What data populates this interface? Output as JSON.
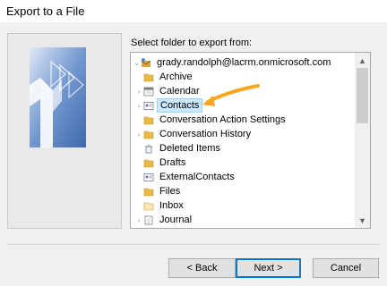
{
  "window": {
    "title": "Export to a File"
  },
  "prompt": "Select folder to export from:",
  "tree": {
    "account": "grady.randolph@lacrm.onmicrosoft.com",
    "items": [
      {
        "label": "Archive",
        "icon": "folder-icon"
      },
      {
        "label": "Calendar",
        "icon": "calendar-icon"
      },
      {
        "label": "Contacts",
        "icon": "contacts-icon"
      },
      {
        "label": "Conversation Action Settings",
        "icon": "folder-icon"
      },
      {
        "label": "Conversation History",
        "icon": "folder-icon"
      },
      {
        "label": "Deleted Items",
        "icon": "trash-icon"
      },
      {
        "label": "Drafts",
        "icon": "folder-icon"
      },
      {
        "label": "ExternalContacts",
        "icon": "contacts-icon"
      },
      {
        "label": "Files",
        "icon": "folder-icon"
      },
      {
        "label": "Inbox",
        "icon": "folder-icon"
      },
      {
        "label": "Journal",
        "icon": "journal-icon"
      }
    ],
    "selected": "Contacts"
  },
  "buttons": {
    "back": "< Back",
    "next": "Next >",
    "cancel": "Cancel"
  },
  "colors": {
    "selection_bg": "#cce8ff",
    "selection_border": "#99d1ff",
    "folder": "#e8b84a",
    "annotation_arrow": "#f5a623",
    "default_button_border": "#0078d7"
  }
}
